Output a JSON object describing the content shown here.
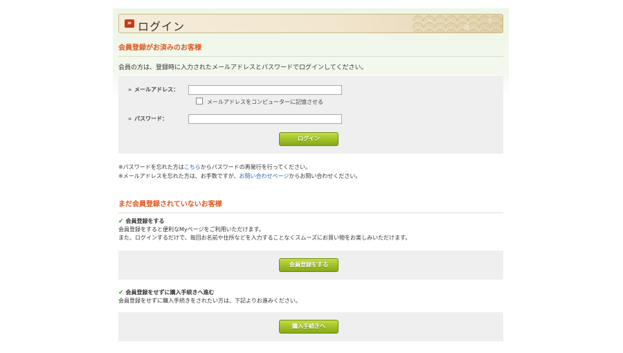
{
  "login_header": {
    "icon": "double-chevron-icon",
    "title": "ログイン"
  },
  "member_section": {
    "heading": "会員登録がお済みのお客様",
    "intro": "会員の方は、登録時に入力されたメールアドレスとパスワードでログインしてください。",
    "email_label": "メールアドレス：",
    "email_value": "",
    "remember_label": "メールアドレスをコンピューターに記憶させる",
    "password_label": "パスワード：",
    "password_value": "",
    "login_button": "ログイン"
  },
  "notes": {
    "pw_prefix": "※パスワードを忘れた方は",
    "pw_link": "こちら",
    "pw_suffix": "からパスワードの再発行を行ってください。",
    "mail_prefix": "※メールアドレスを忘れた方は、お手数ですが、",
    "mail_link": "お問い合わせページ",
    "mail_suffix": "からお問い合わせください。"
  },
  "guest_section": {
    "heading": "まだ会員登録されていないお客様",
    "register_title": "会員登録をする",
    "register_text_1": "会員登録をすると便利なMyページをご利用いただけます。",
    "register_text_2": "また、ログインするだけで、毎回お名前や住所などを入力することなくスムーズにお買い物をお楽しみいただけます。",
    "register_button": "会員登録をする",
    "guest_title": "会員登録をせずに購入手続きへ進む",
    "guest_text": "会員登録をせずに購入手続きをされたい方は、下記よりお進みください。",
    "guest_button": "購入手続きへ"
  },
  "colors": {
    "accent_orange": "#e0581f",
    "button_green": "#a2c227",
    "link_blue": "#1f63b5",
    "check_green": "#3a9b2c"
  }
}
